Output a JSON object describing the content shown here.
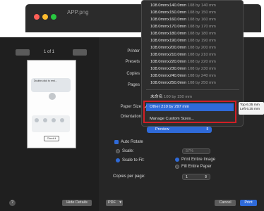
{
  "window": {
    "title": "APP.png"
  },
  "preview": {
    "page_counter": "1 of 1",
    "thumb_title": "Double-click to rest...",
    "thumb_button": "Check it"
  },
  "labels": {
    "printer": "Printer",
    "presets": "Presets",
    "copies": "Copies",
    "pages": "Pages",
    "paper_size": "Paper Size",
    "orientation": "Orientation",
    "copies_per_page": "Copies per page:"
  },
  "paper_menu": {
    "items": [
      {
        "main": "108.0mmx140.0mm",
        "sub": "108 by 140 mm"
      },
      {
        "main": "108.0mmx150.0mm",
        "sub": "108 by 150 mm"
      },
      {
        "main": "108.0mmx160.0mm",
        "sub": "108 by 160 mm"
      },
      {
        "main": "108.0mmx170.0mm",
        "sub": "108 by 170 mm"
      },
      {
        "main": "108.0mmx180.0mm",
        "sub": "108 by 180 mm"
      },
      {
        "main": "108.0mmx190.0mm",
        "sub": "108 by 190 mm"
      },
      {
        "main": "108.0mmx200.0mm",
        "sub": "108 by 200 mm"
      },
      {
        "main": "108.0mmx210.0mm",
        "sub": "108 by 210 mm"
      },
      {
        "main": "108.0mmx220.0mm",
        "sub": "108 by 220 mm"
      },
      {
        "main": "108.0mmx230.0mm",
        "sub": "108 by 230 mm"
      },
      {
        "main": "108.0mmx240.0mm",
        "sub": "108 by 240 mm"
      },
      {
        "main": "108.0mmx250.0mm",
        "sub": "108 by 250 mm"
      }
    ],
    "unnamed": {
      "main": "未命名",
      "sub": "100 by 150 mm"
    },
    "selected": {
      "main": "Other",
      "sub": "210 by 297 mm"
    },
    "manage": "Manage Custom Sizes..."
  },
  "margins_tooltip": {
    "line1": "Top 6.35 mm",
    "line2": "Left 6.35 mm"
  },
  "section_popup": "Preview",
  "options": {
    "auto_rotate": "Auto Rotate",
    "scale": "Scale:",
    "scale_value": "57%",
    "scale_to_fit": "Scale to Fit:",
    "print_entire": "Print Entire Image",
    "fill_paper": "Fill Entire Paper",
    "copies_per_page_value": "1"
  },
  "footer": {
    "help": "?",
    "hide_details": "Hide Details",
    "pdf": "PDF",
    "cancel": "Cancel",
    "print": "Print"
  },
  "colors": {
    "accent": "#2f6ad8",
    "highlight_border": "#d21f26"
  }
}
